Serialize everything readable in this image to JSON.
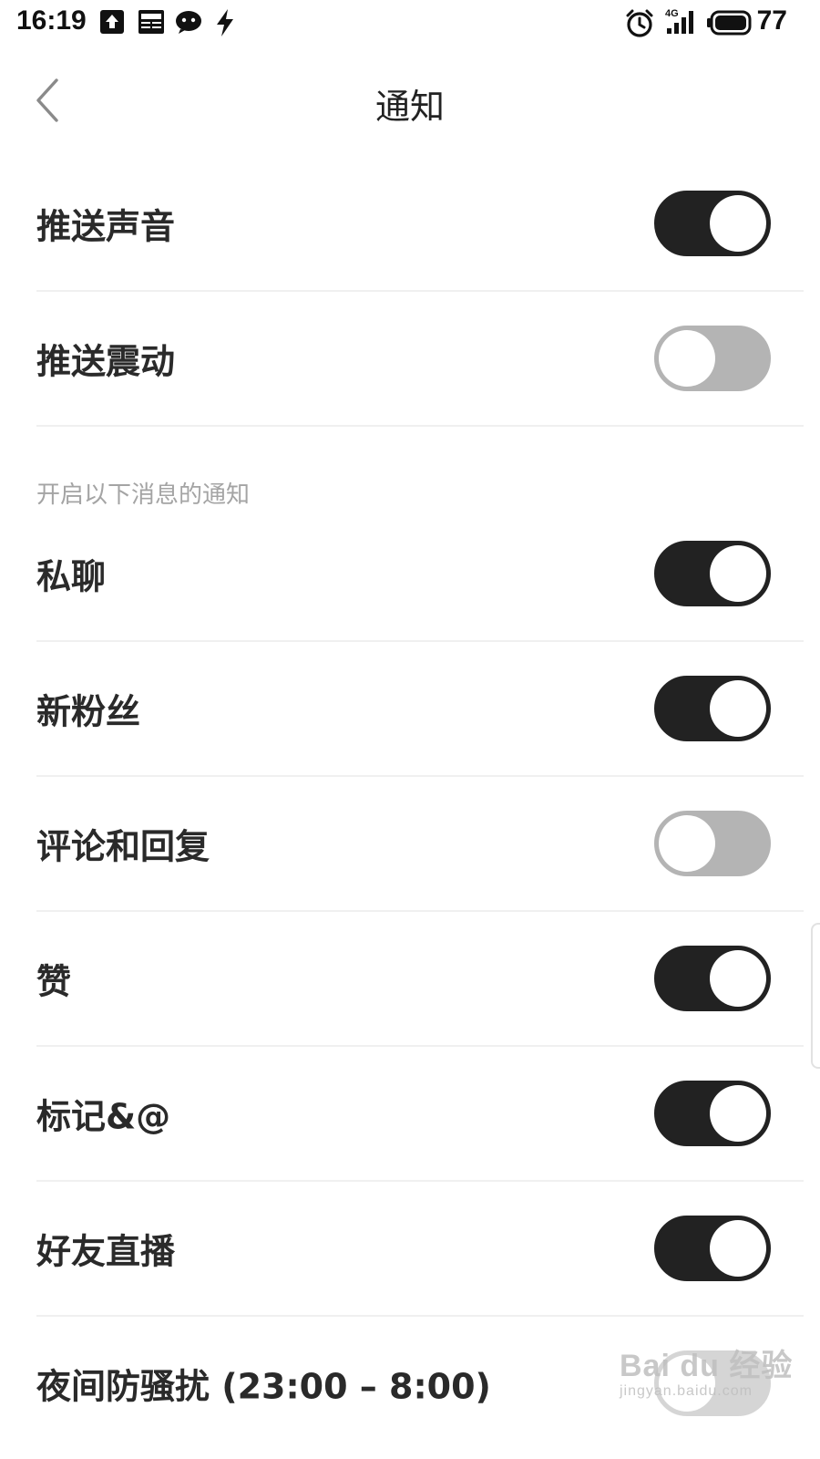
{
  "status_bar": {
    "time": "16:19",
    "network": "4G",
    "battery": "77",
    "icons": [
      "upload-icon",
      "news-icon",
      "wechat-icon",
      "bolt-icon",
      "alarm-icon",
      "signal-icon",
      "battery-icon"
    ]
  },
  "header": {
    "title": "通知",
    "back_icon": "chevron-left-icon"
  },
  "settings": {
    "push_sound": {
      "label": "推送声音",
      "enabled": true
    },
    "push_vibrate": {
      "label": "推送震动",
      "enabled": false
    },
    "section_caption": "开启以下消息的通知",
    "private_chat": {
      "label": "私聊",
      "enabled": true
    },
    "new_fans": {
      "label": "新粉丝",
      "enabled": true
    },
    "comments_replies": {
      "label": "评论和回复",
      "enabled": false
    },
    "likes": {
      "label": "赞",
      "enabled": true
    },
    "mentions": {
      "label": "标记&@",
      "enabled": true
    },
    "friend_live": {
      "label": "好友直播",
      "enabled": true
    },
    "night_dnd": {
      "label": "夜间防骚扰 (23:00 – 8:00)",
      "enabled": false
    }
  },
  "watermark": {
    "brand": "Bai du 经验",
    "url": "jingyan.baidu.com"
  },
  "colors": {
    "toggle_on": "#222222",
    "toggle_off": "#b4b4b4",
    "caption": "#a4a4a4"
  }
}
